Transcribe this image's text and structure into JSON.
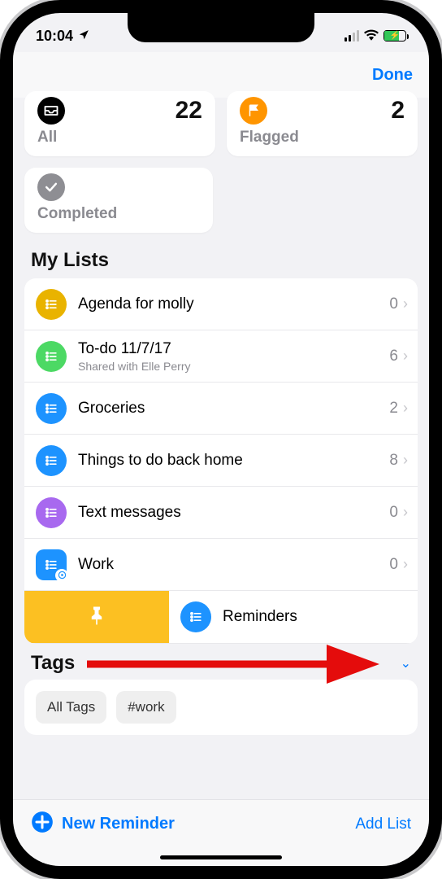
{
  "status": {
    "time": "10:04"
  },
  "nav": {
    "done": "Done"
  },
  "smart_lists": {
    "all": {
      "label": "All",
      "count": "22",
      "color": "#000000"
    },
    "flagged": {
      "label": "Flagged",
      "count": "2",
      "color": "#ff9500"
    },
    "completed": {
      "label": "Completed",
      "count": "",
      "color": "#8e8e93"
    }
  },
  "sections": {
    "my_lists": "My Lists",
    "tags": "Tags"
  },
  "lists": [
    {
      "name": "Agenda for molly",
      "count": "0",
      "color": "#e9b300",
      "shape": "circle"
    },
    {
      "name": "To-do 11/7/17",
      "sub": "Shared with Elle Perry",
      "count": "6",
      "color": "#4cd964",
      "shape": "circle"
    },
    {
      "name": "Groceries",
      "count": "2",
      "color": "#1d93ff",
      "shape": "circle"
    },
    {
      "name": "Things to do back home",
      "count": "8",
      "color": "#1d93ff",
      "shape": "circle"
    },
    {
      "name": "Text messages",
      "count": "0",
      "color": "#a869ef",
      "shape": "circle"
    },
    {
      "name": "Work",
      "count": "0",
      "color": "#1d93ff",
      "shape": "rounded-square",
      "smart": true
    }
  ],
  "swiped_list": {
    "name": "Reminders",
    "color": "#1d93ff"
  },
  "tags": {
    "all": "All Tags",
    "items": [
      "#work"
    ]
  },
  "footer": {
    "new_reminder": "New Reminder",
    "add_list": "Add List"
  }
}
